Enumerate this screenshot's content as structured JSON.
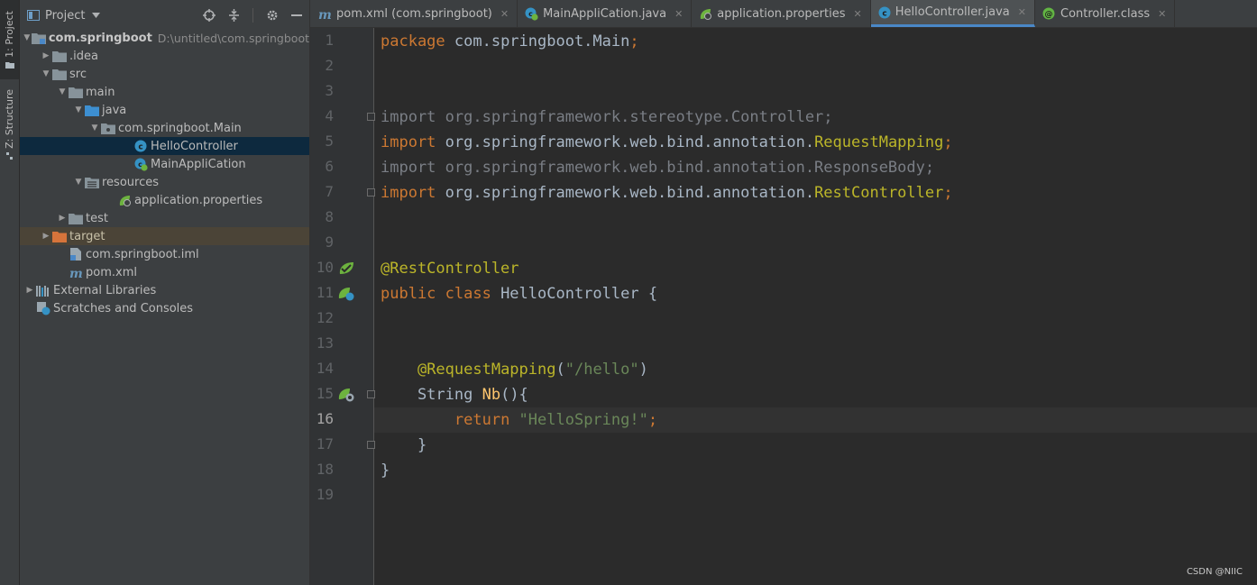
{
  "tool_strip": {
    "project_tab": "1: Project",
    "structure_tab": "Z: Structure"
  },
  "project_panel": {
    "title": "Project",
    "tree": [
      {
        "label": "com.springboot",
        "hint": "D:\\untitled\\com.springboot",
        "icon": "module-folder-icon",
        "arrow": "down"
      },
      {
        "label": ".idea",
        "icon": "folder-icon",
        "arrow": "right"
      },
      {
        "label": "src",
        "icon": "folder-icon",
        "arrow": "down"
      },
      {
        "label": "main",
        "icon": "folder-icon",
        "arrow": "down"
      },
      {
        "label": "java",
        "icon": "source-folder-icon",
        "arrow": "down"
      },
      {
        "label": "com.springboot.Main",
        "icon": "package-icon",
        "arrow": "down"
      },
      {
        "label": "HelloController",
        "icon": "class-icon",
        "arrow": ""
      },
      {
        "label": "MainAppliCation",
        "icon": "spring-boot-class-icon",
        "arrow": ""
      },
      {
        "label": "resources",
        "icon": "resources-folder-icon",
        "arrow": "down"
      },
      {
        "label": "application.properties",
        "icon": "spring-properties-icon",
        "arrow": ""
      },
      {
        "label": "test",
        "icon": "folder-icon",
        "arrow": "right"
      },
      {
        "label": "target",
        "icon": "excluded-folder-icon",
        "arrow": "right"
      },
      {
        "label": "com.springboot.iml",
        "icon": "iml-file-icon",
        "arrow": ""
      },
      {
        "label": "pom.xml",
        "icon": "maven-icon",
        "arrow": ""
      },
      {
        "label": "External Libraries",
        "icon": "libraries-icon",
        "arrow": "right"
      },
      {
        "label": "Scratches and Consoles",
        "icon": "scratches-icon",
        "arrow": ""
      }
    ]
  },
  "tabs": [
    {
      "label": "pom.xml (com.springboot)",
      "icon": "maven-icon",
      "active": false
    },
    {
      "label": "MainAppliCation.java",
      "icon": "spring-boot-class-icon",
      "active": false
    },
    {
      "label": "application.properties",
      "icon": "spring-properties-icon",
      "active": false
    },
    {
      "label": "HelloController.java",
      "icon": "class-icon",
      "active": true
    },
    {
      "label": "Controller.class",
      "icon": "annotation-class-icon",
      "active": false
    }
  ],
  "editor": {
    "current_line": 16,
    "line_numbers": [
      "1",
      "2",
      "3",
      "4",
      "5",
      "6",
      "7",
      "8",
      "9",
      "10",
      "11",
      "12",
      "13",
      "14",
      "15",
      "16",
      "17",
      "18",
      "19"
    ],
    "code": [
      [
        {
          "t": "package ",
          "c": "kw"
        },
        {
          "t": "com.springboot.Main",
          "c": "pl"
        },
        {
          "t": ";",
          "c": "kw"
        }
      ],
      [],
      [],
      [
        {
          "t": "import ",
          "c": "dim"
        },
        {
          "t": "org.springframework.stereotype.Controller;",
          "c": "dim"
        }
      ],
      [
        {
          "t": "import ",
          "c": "kw"
        },
        {
          "t": "org.springframework.web.bind.annotation.",
          "c": "pl"
        },
        {
          "t": "RequestMapping",
          "c": "ann"
        },
        {
          "t": ";",
          "c": "kw"
        }
      ],
      [
        {
          "t": "import ",
          "c": "dim"
        },
        {
          "t": "org.springframework.web.bind.annotation.ResponseBody;",
          "c": "dim"
        }
      ],
      [
        {
          "t": "import ",
          "c": "kw"
        },
        {
          "t": "org.springframework.web.bind.annotation.",
          "c": "pl"
        },
        {
          "t": "RestController",
          "c": "ann"
        },
        {
          "t": ";",
          "c": "kw"
        }
      ],
      [],
      [],
      [
        {
          "t": "@RestController",
          "c": "ann"
        }
      ],
      [
        {
          "t": "public class ",
          "c": "kw"
        },
        {
          "t": "HelloController {",
          "c": "pl"
        }
      ],
      [],
      [],
      [
        {
          "t": "    ",
          "c": "pl"
        },
        {
          "t": "@RequestMapping",
          "c": "ann"
        },
        {
          "t": "(",
          "c": "pl"
        },
        {
          "t": "\"/hello\"",
          "c": "str"
        },
        {
          "t": ")",
          "c": "pl"
        }
      ],
      [
        {
          "t": "    String ",
          "c": "pl"
        },
        {
          "t": "Nb",
          "c": "fn"
        },
        {
          "t": "(){",
          "c": "pl"
        }
      ],
      [
        {
          "t": "        ",
          "c": "pl"
        },
        {
          "t": "return ",
          "c": "kw"
        },
        {
          "t": "\"HelloSpring!\"",
          "c": "str"
        },
        {
          "t": ";",
          "c": "kw"
        }
      ],
      [
        {
          "t": "    }",
          "c": "pl"
        }
      ],
      [
        {
          "t": "}",
          "c": "pl"
        }
      ],
      []
    ]
  },
  "watermark": "CSDN @NIIC",
  "colors": {
    "keyword": "#cc7832",
    "annotation": "#bbb529",
    "string": "#6a8759",
    "plain": "#a9b7c6",
    "unused_import": "#7a7e85",
    "selection": "#0d293e",
    "excluded_row": "#4b4437",
    "active_tab_underline": "#4a88c7"
  }
}
